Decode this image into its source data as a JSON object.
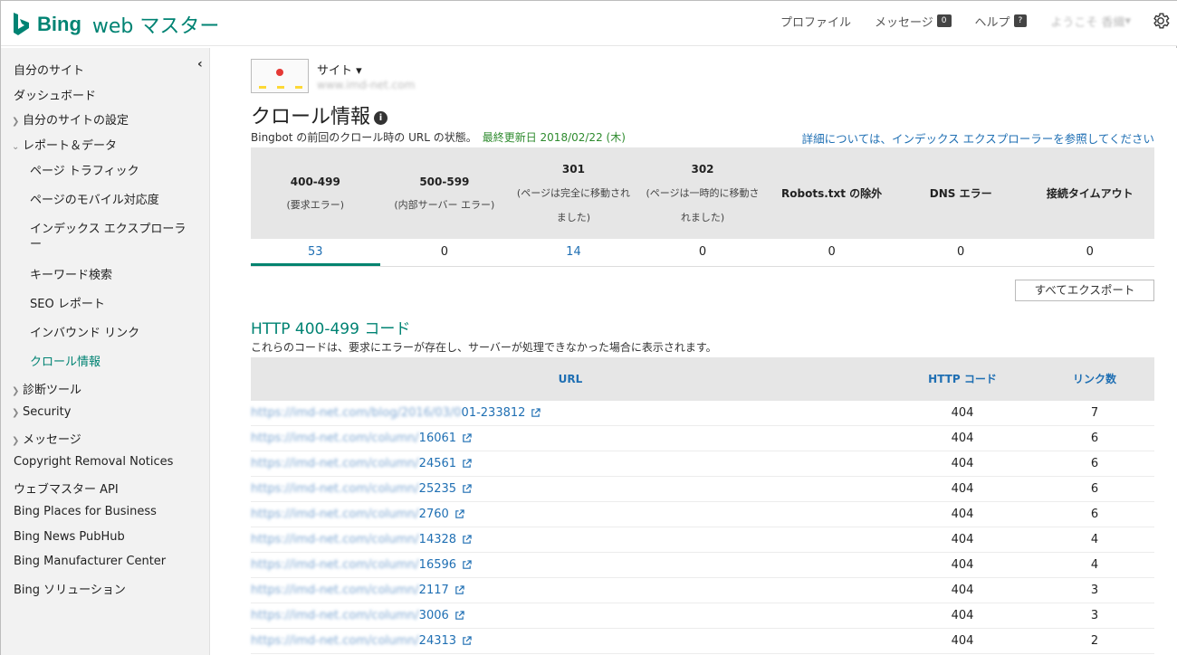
{
  "brand": {
    "name": "Bing",
    "product": "web マスター",
    "brand_color": "#008373"
  },
  "topnav": {
    "profile": "プロファイル",
    "messages": "メッセージ",
    "messages_count": "0",
    "help": "ヘルプ",
    "help_badge": "?",
    "welcome": "ようこそ 香織"
  },
  "sidebar": {
    "items": [
      {
        "label": "自分のサイト"
      },
      {
        "label": "ダッシュボード"
      },
      {
        "label": "自分のサイトの設定"
      },
      {
        "label": "レポート＆データ"
      },
      {
        "label": "ページ トラフィック"
      },
      {
        "label": "ページのモバイル対応度"
      },
      {
        "label": "インデックス エクスプローラー"
      },
      {
        "label": "キーワード検索"
      },
      {
        "label": "SEO レポート"
      },
      {
        "label": "インバウンド リンク"
      },
      {
        "label": "クロール情報"
      },
      {
        "label": "診断ツール"
      },
      {
        "label": "Security"
      },
      {
        "label": "メッセージ"
      },
      {
        "label": "Copyright Removal Notices"
      },
      {
        "label": "ウェブマスター API"
      },
      {
        "label": "Bing Places for Business"
      },
      {
        "label": "Bing News PubHub"
      },
      {
        "label": "Bing Manufacturer Center"
      },
      {
        "label": "Bing ソリューション"
      }
    ]
  },
  "site": {
    "label": "サイト",
    "url": "www.imd-net.com"
  },
  "page": {
    "title": "クロール情報",
    "subtitle": "Bingbot の前回のクロール時の URL の状態。",
    "updated": "最終更新日 2018/02/22 (木)",
    "detail_link": "詳細については、インデックス エクスプローラーを参照してください"
  },
  "stats": [
    {
      "code": "400-499",
      "desc": "(要求エラー)",
      "value": "53"
    },
    {
      "code": "500-599",
      "desc": "(内部サーバー エラー)",
      "value": "0"
    },
    {
      "code": "301",
      "desc": "(ページは完全に移動されました)",
      "value": "14"
    },
    {
      "code": "302",
      "desc": "(ページは一時的に移動されました)",
      "value": "0"
    },
    {
      "code": "Robots.txt の除外",
      "desc": "",
      "value": "0"
    },
    {
      "code": "DNS エラー",
      "desc": "",
      "value": "0"
    },
    {
      "code": "接続タイムアウト",
      "desc": "",
      "value": "0"
    }
  ],
  "export_label": "すべてエクスポート",
  "section": {
    "title": "HTTP 400-499 コード",
    "desc": "これらのコードは、要求にエラーが存在し、サーバーが処理できなかった場合に表示されます。"
  },
  "table": {
    "headers": [
      "URL",
      "HTTP コード",
      "リンク数"
    ],
    "rows": [
      {
        "url_prefix": "https://imd-net.com/blog/2016/03/0",
        "url_suffix": "01-233812",
        "code": "404",
        "links": "7"
      },
      {
        "url_prefix": "https://imd-net.com/column/",
        "url_suffix": "16061",
        "code": "404",
        "links": "6"
      },
      {
        "url_prefix": "https://imd-net.com/column/",
        "url_suffix": "24561",
        "code": "404",
        "links": "6"
      },
      {
        "url_prefix": "https://imd-net.com/column/",
        "url_suffix": "25235",
        "code": "404",
        "links": "6"
      },
      {
        "url_prefix": "https://imd-net.com/column/",
        "url_suffix": "2760",
        "code": "404",
        "links": "6"
      },
      {
        "url_prefix": "https://imd-net.com/column/",
        "url_suffix": "14328",
        "code": "404",
        "links": "4"
      },
      {
        "url_prefix": "https://imd-net.com/column/",
        "url_suffix": "16596",
        "code": "404",
        "links": "4"
      },
      {
        "url_prefix": "https://imd-net.com/column/",
        "url_suffix": "2117",
        "code": "404",
        "links": "3"
      },
      {
        "url_prefix": "https://imd-net.com/column/",
        "url_suffix": "3006",
        "code": "404",
        "links": "3"
      },
      {
        "url_prefix": "https://imd-net.com/column/",
        "url_suffix": "24313",
        "code": "404",
        "links": "2"
      }
    ]
  }
}
